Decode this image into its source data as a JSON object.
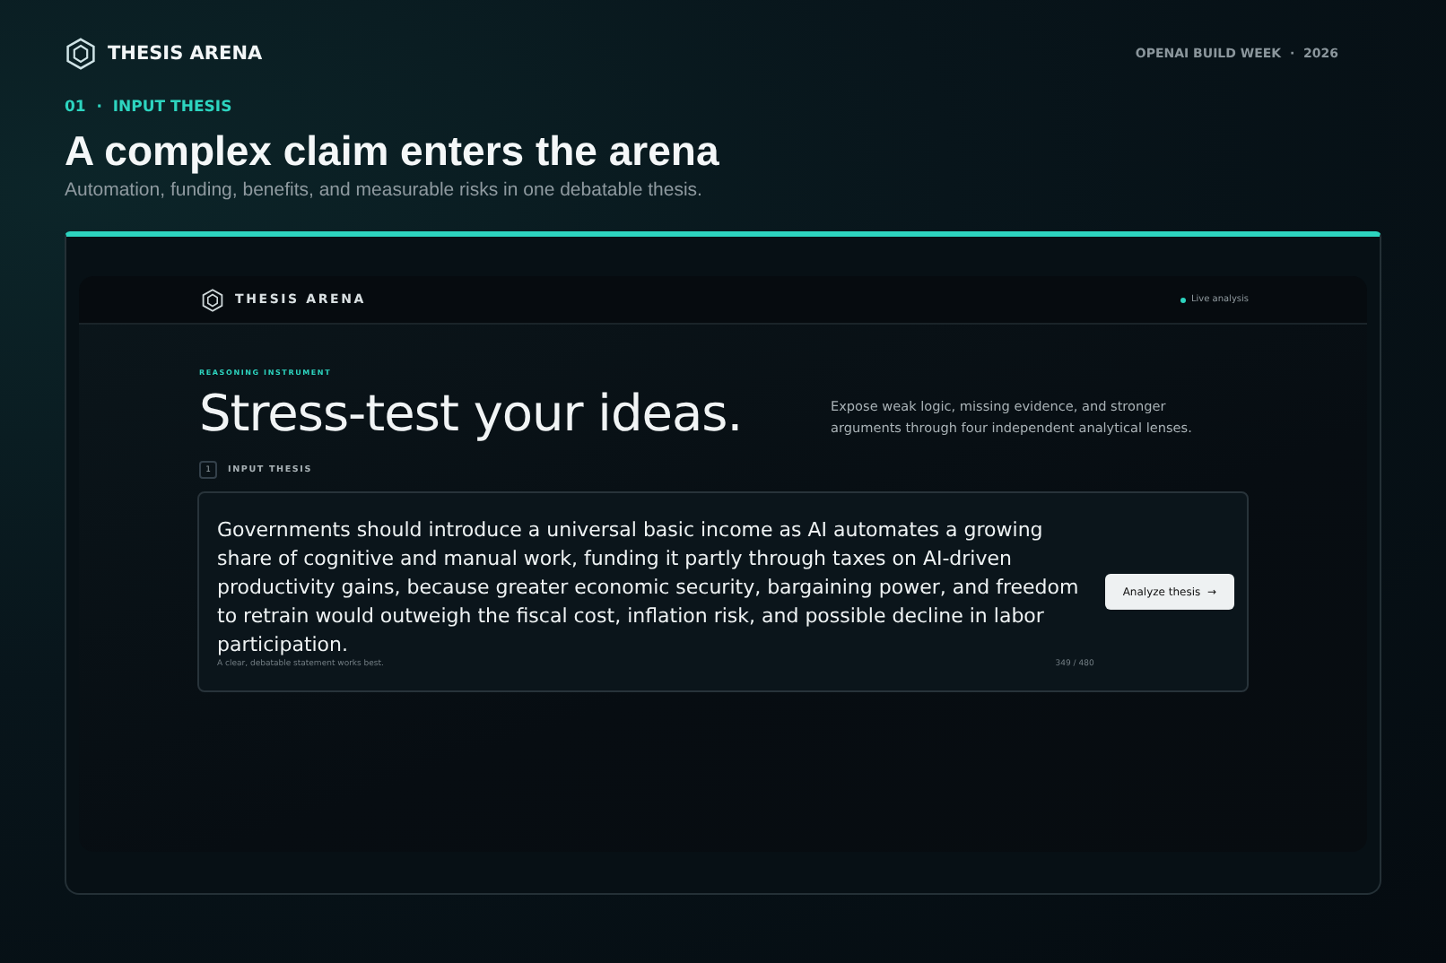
{
  "brand": {
    "name": "THESIS ARENA"
  },
  "event": {
    "name": "OPENAI BUILD WEEK",
    "separator": "·",
    "year": "2026"
  },
  "step": {
    "number": "01",
    "separator": "·",
    "label": "INPUT THESIS"
  },
  "title": "A complex claim enters the arena",
  "subtitle": "Automation, funding, benefits, and measurable risks in one debatable thesis.",
  "app": {
    "brand": "THESIS ARENA",
    "status": {
      "label": "Live analysis",
      "color": "#2dd4bf"
    },
    "eyebrow": "REASONING INSTRUMENT",
    "headline": "Stress-test your ideas.",
    "description": "Expose weak logic, missing evidence, and stronger arguments through four independent analytical lenses.",
    "input_step": {
      "number": "1",
      "label": "INPUT THESIS"
    },
    "thesis": {
      "value": "Governments should introduce a universal basic income as AI automates a growing share of cognitive and manual work, funding it partly through taxes on AI-driven productivity gains, because greater economic security, bargaining power, and freedom to retrain would outweigh the fiscal cost, inflation risk, and possible decline in labor participation.",
      "hint": "A clear, debatable statement works best.",
      "count": "349 / 480"
    },
    "button": {
      "label": "Analyze thesis",
      "arrow": "→"
    }
  }
}
